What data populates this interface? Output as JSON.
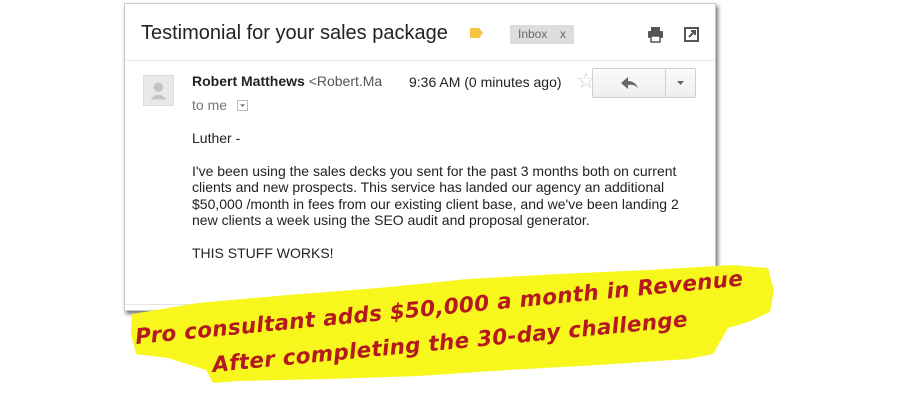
{
  "email": {
    "subject": "Testimonial for your sales package",
    "label_chip": "Inbox",
    "label_chip_remove": "x",
    "sender_name": "Robert Matthews",
    "sender_email_fragment": "<Robert.Ma",
    "time": "9:36 AM (0 minutes ago)",
    "recipient": "to me",
    "body": {
      "greeting": "Luther -",
      "paragraph": "I've been using the sales decks you sent for the past 3 months both on current clients and new prospects. This service has landed our agency an additional $50,000 /month in fees from our existing client base, and we've been landing 2 new clients a week using the SEO audit and proposal generator.",
      "closing": "THIS STUFF WORKS!"
    }
  },
  "icons": {
    "label_tag": "label-tag-icon",
    "print": "print-icon",
    "new_window": "new-window-icon",
    "avatar": "avatar-icon",
    "star": "star-icon",
    "reply": "reply-icon",
    "more": "chevron-down-icon",
    "details": "chevron-down-icon"
  },
  "caption": {
    "line1": "Pro consultant adds $50,000 a month in Revenue",
    "line2": "After completing the 30-day challenge"
  },
  "colors": {
    "highlight": "#f7f71e",
    "caption_text": "#b3191f",
    "label_tag": "#f6c443"
  }
}
